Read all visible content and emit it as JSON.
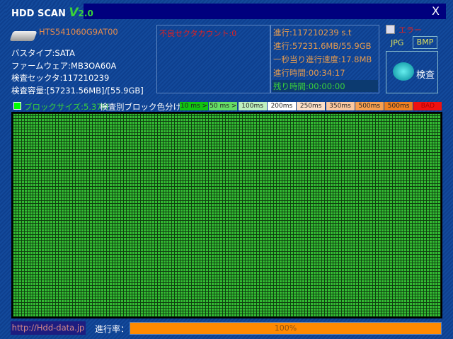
{
  "title": {
    "name": "HDD SCAN",
    "v": "V",
    "ver": "2.0"
  },
  "close": "X",
  "drive": {
    "model": "HTS541060G9AT00",
    "bus": "バスタイプ:SATA",
    "firmware": "ファームウェア:MB3OA60A",
    "sectors": "検査セックタ:117210239",
    "capacity": "検査容量:[57231.56MB]/[55.9GB]"
  },
  "bad_sectors": "不良セクタカウント:0",
  "stats": [
    "進行:117210239 s.t",
    "進行:57231.6MB/55.9GB",
    "一秒当り進行速度:17.8MB",
    "進行時間:00:34:17"
  ],
  "remaining": "残り時間:00:00:00",
  "error_label": "エラー",
  "jpg": "JPG",
  "bmp": "BMP",
  "scan": "検査",
  "block_size": "ブロックサイズ:5.37M",
  "legend_label": "検査別ブロック色分け：",
  "legend": [
    {
      "t": "10 ms >",
      "c": "#11c411"
    },
    {
      "t": "50 ms >",
      "c": "#66dd66"
    },
    {
      "t": "100ms >",
      "c": "#bff0bf"
    },
    {
      "t": "200ms >",
      "c": "#ffffff"
    },
    {
      "t": "250ms >",
      "c": "#fde0c8"
    },
    {
      "t": "350ms >",
      "c": "#fbc8a0"
    },
    {
      "t": "500ms >",
      "c": "#f7a050"
    },
    {
      "t": "500ms <",
      "c": "#f08020"
    },
    {
      "t": "BAD",
      "c": "#ee1111"
    }
  ],
  "url": "http://Hdd-data.jp",
  "progress_label": "進行率：",
  "progress_percent": 100,
  "progress_text": "100%",
  "colors": {
    "accent": "#ff8a00",
    "title_bar": "#00007e",
    "block_ok": "#33bb33"
  }
}
